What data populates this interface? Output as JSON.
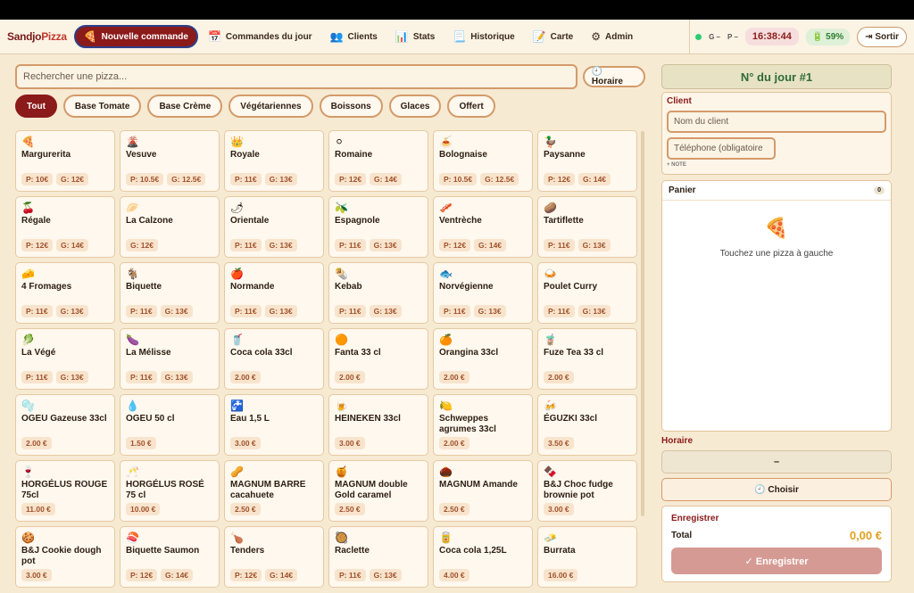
{
  "nav": {
    "logo_a": "Sandjo",
    "logo_b": "Pizza",
    "items": [
      {
        "icon": "🍕",
        "label": "Nouvelle commande"
      },
      {
        "icon": "📅",
        "label": "Commandes du jour"
      },
      {
        "icon": "👥",
        "label": "Clients"
      },
      {
        "icon": "📊",
        "label": "Stats"
      },
      {
        "icon": "📃",
        "label": "Historique"
      },
      {
        "icon": "📝",
        "label": "Carte"
      },
      {
        "icon": "⚙",
        "label": "Admin"
      }
    ],
    "status_g": "G –",
    "status_p": "P –",
    "clock": "16:38:44",
    "battery": "🔋 59%",
    "logout": "⇥ Sortir"
  },
  "search": {
    "placeholder": "Rechercher une pizza...",
    "horaire": "🕘 Horaire"
  },
  "filters": [
    "Tout",
    "Base Tomate",
    "Base Crème",
    "Végétariennes",
    "Boissons",
    "Glaces",
    "Offert"
  ],
  "products": [
    {
      "icon": "🍕",
      "name": "Margurerita",
      "p": "P: 10€",
      "g": "G: 12€"
    },
    {
      "icon": "🌋",
      "name": "Vesuve",
      "p": "P: 10.5€",
      "g": "G: 12.5€"
    },
    {
      "icon": "👑",
      "name": "Royale",
      "p": "P: 11€",
      "g": "G: 13€"
    },
    {
      "icon": "⚪",
      "name": "Romaine",
      "p": "P: 12€",
      "g": "G: 14€"
    },
    {
      "icon": "🍝",
      "name": "Bolognaise",
      "p": "P: 10.5€",
      "g": "G: 12.5€"
    },
    {
      "icon": "🦆",
      "name": "Paysanne",
      "p": "P: 12€",
      "g": "G: 14€"
    },
    {
      "icon": "🍒",
      "name": "Régale",
      "p": "P: 12€",
      "g": "G: 14€"
    },
    {
      "icon": "🥟",
      "name": "La Calzone",
      "p": "G: 12€",
      "g": ""
    },
    {
      "icon": "🌶",
      "name": "Orientale",
      "p": "P: 11€",
      "g": "G: 13€"
    },
    {
      "icon": "🫒",
      "name": "Espagnole",
      "p": "P: 11€",
      "g": "G: 13€"
    },
    {
      "icon": "🥓",
      "name": "Ventrèche",
      "p": "P: 12€",
      "g": "G: 14€"
    },
    {
      "icon": "🥔",
      "name": "Tartiflette",
      "p": "P: 11€",
      "g": "G: 13€"
    },
    {
      "icon": "🧀",
      "name": "4 Fromages",
      "p": "P: 11€",
      "g": "G: 13€"
    },
    {
      "icon": "🐐",
      "name": "Biquette",
      "p": "P: 11€",
      "g": "G: 13€"
    },
    {
      "icon": "🍎",
      "name": "Normande",
      "p": "P: 11€",
      "g": "G: 13€"
    },
    {
      "icon": "🌯",
      "name": "Kebab",
      "p": "P: 11€",
      "g": "G: 13€"
    },
    {
      "icon": "🐟",
      "name": "Norvégienne",
      "p": "P: 11€",
      "g": "G: 13€"
    },
    {
      "icon": "🍛",
      "name": "Poulet Curry",
      "p": "P: 11€",
      "g": "G: 13€"
    },
    {
      "icon": "🥬",
      "name": "La Végé",
      "p": "P: 11€",
      "g": "G: 13€"
    },
    {
      "icon": "🍆",
      "name": "La Mélisse",
      "p": "P: 11€",
      "g": "G: 13€"
    },
    {
      "icon": "🥤",
      "name": "Coca cola 33cl",
      "p": "2.00 €",
      "g": ""
    },
    {
      "icon": "🟠",
      "name": "Fanta 33 cl",
      "p": "2.00 €",
      "g": ""
    },
    {
      "icon": "🍊",
      "name": "Orangina 33cl",
      "p": "2.00 €",
      "g": ""
    },
    {
      "icon": "🧋",
      "name": "Fuze Tea 33 cl",
      "p": "2.00 €",
      "g": ""
    },
    {
      "icon": "🫧",
      "name": "OGEU Gazeuse 33cl",
      "p": "2.00 €",
      "g": ""
    },
    {
      "icon": "💧",
      "name": "OGEU 50 cl",
      "p": "1.50 €",
      "g": ""
    },
    {
      "icon": "🚰",
      "name": "Eau 1,5 L",
      "p": "3.00 €",
      "g": ""
    },
    {
      "icon": "🍺",
      "name": "HEINEKEN 33cl",
      "p": "3.00 €",
      "g": ""
    },
    {
      "icon": "🍋",
      "name": "Schweppes agrumes 33cl",
      "p": "2.00 €",
      "g": ""
    },
    {
      "icon": "🍻",
      "name": "ÉGUZKI 33cl",
      "p": "3.50 €",
      "g": ""
    },
    {
      "icon": "🍷",
      "name": "HORGÉLUS ROUGE 75cl",
      "p": "11.00 €",
      "g": ""
    },
    {
      "icon": "🥂",
      "name": "HORGÉLUS ROSÉ 75 cl",
      "p": "10.00 €",
      "g": ""
    },
    {
      "icon": "🥜",
      "name": "MAGNUM BARRE cacahuete",
      "p": "2.50 €",
      "g": ""
    },
    {
      "icon": "🍯",
      "name": "MAGNUM double Gold caramel",
      "p": "2.50 €",
      "g": ""
    },
    {
      "icon": "🌰",
      "name": "MAGNUM Amande",
      "p": "2.50 €",
      "g": ""
    },
    {
      "icon": "🍫",
      "name": "B&J Choc fudge brownie pot",
      "p": "3.00 €",
      "g": ""
    },
    {
      "icon": "🍪",
      "name": "B&J Cookie dough pot",
      "p": "3.00 €",
      "g": ""
    },
    {
      "icon": "🍣",
      "name": "Biquette Saumon",
      "p": "P: 12€",
      "g": "G: 14€"
    },
    {
      "icon": "🍗",
      "name": "Tenders",
      "p": "P: 12€",
      "g": "G: 14€"
    },
    {
      "icon": "🥘",
      "name": "Raclette",
      "p": "P: 11€",
      "g": "G: 13€"
    },
    {
      "icon": "🥫",
      "name": "Coca cola 1,25L",
      "p": "4.00 €",
      "g": ""
    },
    {
      "icon": "🧈",
      "name": "Burrata",
      "p": "16.00 €",
      "g": ""
    }
  ],
  "order": {
    "day_number": "N° du jour #1",
    "client_title": "Client",
    "name_placeholder": "Nom du client",
    "phone_placeholder": "Téléphone (obligatoire",
    "note": "+ NOTE",
    "cart_title": "Panier",
    "cart_count": "0",
    "cart_icon": "🍕",
    "cart_empty": "Touchez une pizza à gauche",
    "horaire_title": "Horaire",
    "horaire_value": "–",
    "choisir": "🕘 Choisir",
    "save_title": "Enregistrer",
    "total_label": "Total",
    "total_value": "0,00 €",
    "save_button": "✓ Enregistrer"
  }
}
